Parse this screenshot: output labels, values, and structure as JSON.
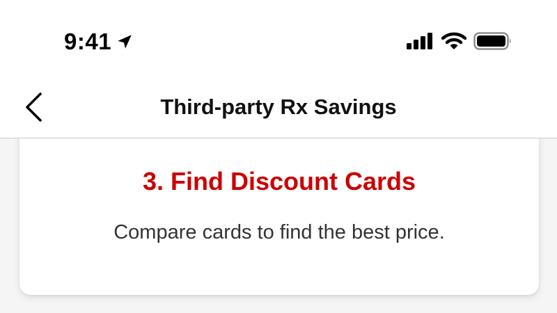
{
  "status_bar": {
    "time": "9:41",
    "icons": [
      "location-arrow-icon",
      "cellular-signal-icon",
      "wifi-icon",
      "battery-icon"
    ]
  },
  "nav": {
    "title": "Third-party Rx Savings",
    "back_icon": "chevron-left-icon"
  },
  "card": {
    "title": "3. Find Discount Cards",
    "description": "Compare cards to find the best price."
  },
  "colors": {
    "accent_red": "#cc0000",
    "text_dark": "#111111",
    "text_body": "#333333",
    "page_bg": "#f5f5f5"
  }
}
